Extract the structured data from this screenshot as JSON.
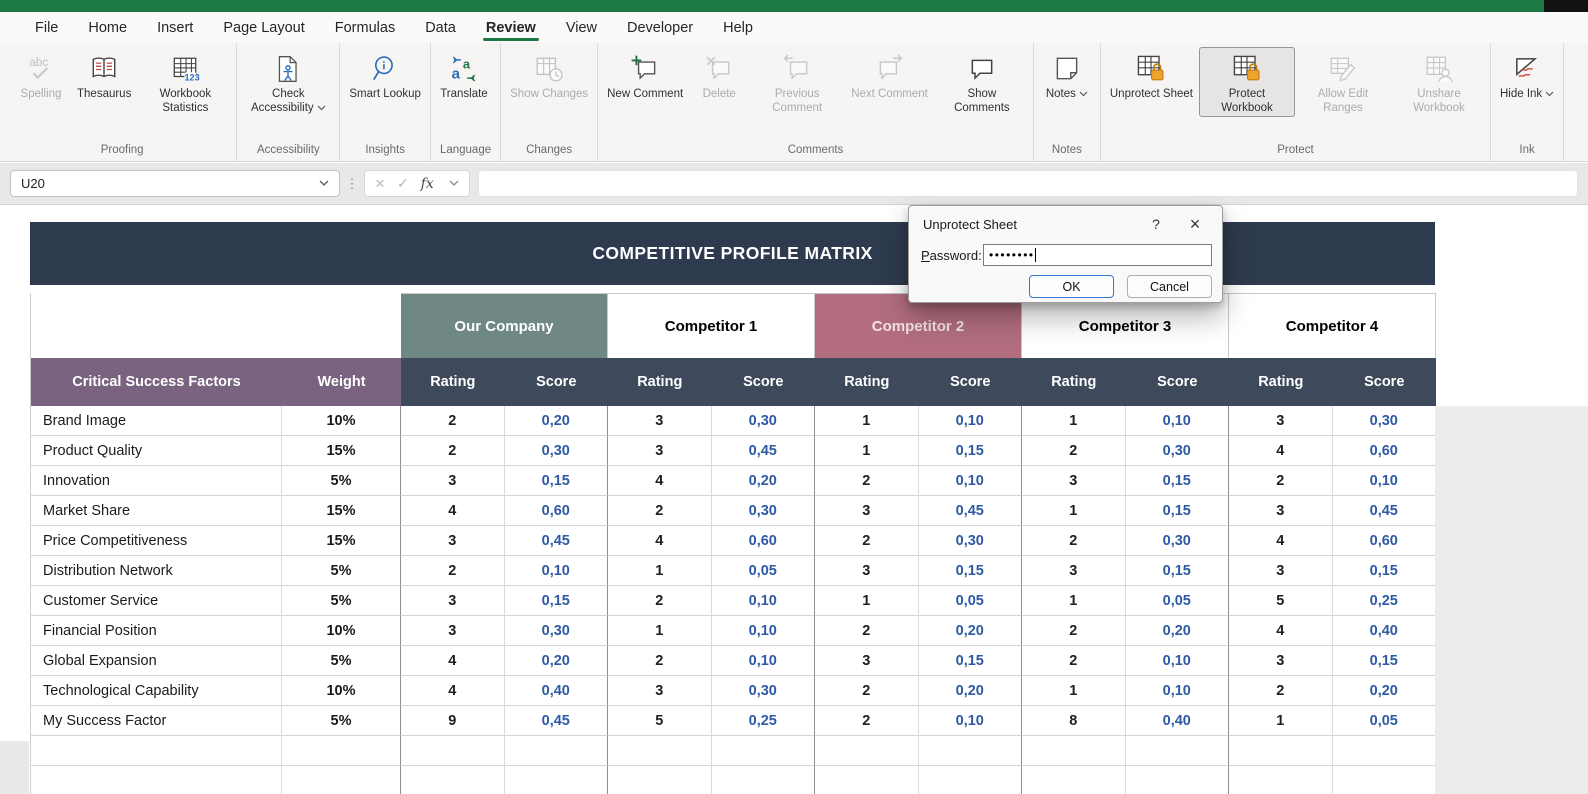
{
  "menubar": {
    "tabs": [
      "File",
      "Home",
      "Insert",
      "Page Layout",
      "Formulas",
      "Data",
      "Review",
      "View",
      "Developer",
      "Help"
    ],
    "active_tab": "Review"
  },
  "ribbon": {
    "groups": [
      {
        "label": "Proofing",
        "buttons": [
          {
            "label": "Spelling",
            "icon": "spelling-icon",
            "disabled": true
          },
          {
            "label": "Thesaurus",
            "icon": "thesaurus-icon"
          },
          {
            "label": "Workbook Statistics",
            "icon": "workbook-statistics-icon"
          }
        ]
      },
      {
        "label": "Accessibility",
        "buttons": [
          {
            "label": "Check Accessibility",
            "icon": "check-accessibility-icon",
            "dropdown": true
          }
        ]
      },
      {
        "label": "Insights",
        "buttons": [
          {
            "label": "Smart Lookup",
            "icon": "smart-lookup-icon"
          }
        ]
      },
      {
        "label": "Language",
        "buttons": [
          {
            "label": "Translate",
            "icon": "translate-icon"
          }
        ]
      },
      {
        "label": "Changes",
        "buttons": [
          {
            "label": "Show Changes",
            "icon": "show-changes-icon",
            "disabled": true
          }
        ]
      },
      {
        "label": "Comments",
        "buttons": [
          {
            "label": "New Comment",
            "icon": "new-comment-icon"
          },
          {
            "label": "Delete",
            "icon": "delete-comment-icon",
            "disabled": true
          },
          {
            "label": "Previous Comment",
            "icon": "previous-comment-icon",
            "disabled": true
          },
          {
            "label": "Next Comment",
            "icon": "next-comment-icon",
            "disabled": true
          },
          {
            "label": "Show Comments",
            "icon": "show-comments-icon"
          }
        ]
      },
      {
        "label": "Notes",
        "buttons": [
          {
            "label": "Notes",
            "icon": "notes-icon",
            "dropdown": true
          }
        ]
      },
      {
        "label": "Protect",
        "buttons": [
          {
            "label": "Unprotect Sheet",
            "icon": "unprotect-sheet-icon"
          },
          {
            "label": "Protect Workbook",
            "icon": "protect-workbook-icon",
            "active": true
          },
          {
            "label": "Allow Edit Ranges",
            "icon": "allow-edit-ranges-icon",
            "disabled": true
          },
          {
            "label": "Unshare Workbook",
            "icon": "unshare-workbook-icon",
            "disabled": true
          }
        ]
      },
      {
        "label": "Ink",
        "buttons": [
          {
            "label": "Hide Ink",
            "icon": "hide-ink-icon",
            "dropdown": true
          }
        ]
      }
    ]
  },
  "formula_bar": {
    "name_box_value": "U20",
    "options_glyph": "⋮",
    "cancel_glyph": "×",
    "enter_glyph": "✓",
    "fx_label": "fx",
    "formula_value": ""
  },
  "dialog": {
    "title": "Unprotect Sheet",
    "help_glyph": "?",
    "close_glyph": "×",
    "password_label": "Password:",
    "password_value": "••••••••",
    "ok_label": "OK",
    "cancel_label": "Cancel"
  },
  "sheet": {
    "title": "COMPETITIVE PROFILE MATRIX",
    "factor_header": "Critical Success Factors",
    "weight_header": "Weight",
    "rating_header": "Rating",
    "score_header": "Score",
    "companies": [
      {
        "name": "Our Company",
        "bg": "#6F8886",
        "fg": "#FFFFFF"
      },
      {
        "name": "Competitor 1",
        "bg": "#FFFFFF",
        "fg": "#000000"
      },
      {
        "name": "Competitor 2",
        "bg": "#B26E7E",
        "fg": "#F2E2E6"
      },
      {
        "name": "Competitor 3",
        "bg": "#FFFFFF",
        "fg": "#000000"
      },
      {
        "name": "Competitor 4",
        "bg": "#FFFFFF",
        "fg": "#000000"
      }
    ],
    "rows": [
      {
        "factor": "Brand Image",
        "weight": "10%",
        "ratings": [
          2,
          3,
          1,
          1,
          3
        ],
        "scores": [
          "0,20",
          "0,30",
          "0,10",
          "0,10",
          "0,30"
        ]
      },
      {
        "factor": "Product Quality",
        "weight": "15%",
        "ratings": [
          2,
          3,
          1,
          2,
          4
        ],
        "scores": [
          "0,30",
          "0,45",
          "0,15",
          "0,30",
          "0,60"
        ]
      },
      {
        "factor": "Innovation",
        "weight": "5%",
        "ratings": [
          3,
          4,
          2,
          3,
          2
        ],
        "scores": [
          "0,15",
          "0,20",
          "0,10",
          "0,15",
          "0,10"
        ]
      },
      {
        "factor": "Market Share",
        "weight": "15%",
        "ratings": [
          4,
          2,
          3,
          1,
          3
        ],
        "scores": [
          "0,60",
          "0,30",
          "0,45",
          "0,15",
          "0,45"
        ]
      },
      {
        "factor": "Price Competitiveness",
        "weight": "15%",
        "ratings": [
          3,
          4,
          2,
          2,
          4
        ],
        "scores": [
          "0,45",
          "0,60",
          "0,30",
          "0,30",
          "0,60"
        ]
      },
      {
        "factor": "Distribution Network",
        "weight": "5%",
        "ratings": [
          2,
          1,
          3,
          3,
          3
        ],
        "scores": [
          "0,10",
          "0,05",
          "0,15",
          "0,15",
          "0,15"
        ]
      },
      {
        "factor": "Customer Service",
        "weight": "5%",
        "ratings": [
          3,
          2,
          1,
          1,
          5
        ],
        "scores": [
          "0,15",
          "0,10",
          "0,05",
          "0,05",
          "0,25"
        ]
      },
      {
        "factor": "Financial Position",
        "weight": "10%",
        "ratings": [
          3,
          1,
          2,
          2,
          4
        ],
        "scores": [
          "0,30",
          "0,10",
          "0,20",
          "0,20",
          "0,40"
        ]
      },
      {
        "factor": "Global Expansion",
        "weight": "5%",
        "ratings": [
          4,
          2,
          3,
          2,
          3
        ],
        "scores": [
          "0,20",
          "0,10",
          "0,15",
          "0,10",
          "0,15"
        ]
      },
      {
        "factor": "Technological Capability",
        "weight": "10%",
        "ratings": [
          4,
          3,
          2,
          1,
          2
        ],
        "scores": [
          "0,40",
          "0,30",
          "0,20",
          "0,10",
          "0,20"
        ]
      },
      {
        "factor": "My Success Factor",
        "weight": "5%",
        "ratings": [
          9,
          5,
          2,
          8,
          1
        ],
        "scores": [
          "0,45",
          "0,25",
          "0,10",
          "0,40",
          "0,05"
        ]
      }
    ],
    "empty_row_count": 2
  },
  "colors": {
    "excel_green": "#1E7A43",
    "banner_navy": "#2E3B4E",
    "header_purple": "#7A6380",
    "header_slate": "#3E4A5B",
    "our_company_teal": "#6F8886",
    "competitor2_rose": "#B26E7E",
    "score_blue": "#2E5AA5",
    "lock_orange": "#F0A32A"
  }
}
